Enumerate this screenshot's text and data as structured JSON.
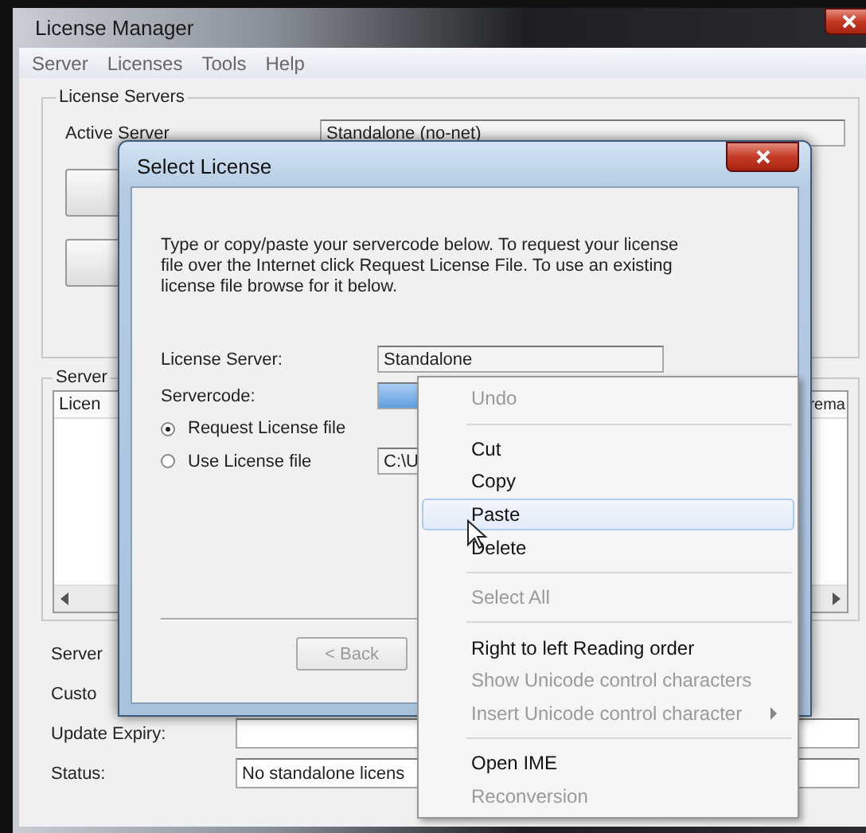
{
  "window": {
    "title": "License Manager"
  },
  "menu_bar": [
    "Server",
    "Licenses",
    "Tools",
    "Help"
  ],
  "license_servers": {
    "legend": "License Servers",
    "active_server_label": "Active Server",
    "active_server_value": "Standalone (no-net)"
  },
  "server_group": {
    "legend": "Server",
    "columns": [
      "Licen",
      "rema"
    ]
  },
  "form_rows": [
    {
      "label": "Server",
      "kind": "label"
    },
    {
      "label": "Custo",
      "kind": "label"
    },
    {
      "label": "Update Expiry:",
      "kind": "field"
    },
    {
      "label": "Status:",
      "kind": "field",
      "value": "No standalone licens"
    }
  ],
  "dialog": {
    "title": "Select License",
    "instructions": "Type or copy/paste your servercode below. To request your license file over the Internet click Request License File. To use an existing license file browse for it below.",
    "license_server_label": "License Server:",
    "license_server_value": "Standalone",
    "servercode_label": "Servercode:",
    "servercode_selected": true,
    "options": [
      {
        "label": "Request License file",
        "selected": true
      },
      {
        "label": "Use License file",
        "selected": false
      }
    ],
    "license_file_value": "C:\\U",
    "back_button": {
      "label": "< Back",
      "disabled": true
    }
  },
  "context_menu": {
    "items": [
      {
        "kind": "item",
        "label": "Undo",
        "disabled": true,
        "selected": false,
        "submenu": false
      },
      {
        "kind": "separator"
      },
      {
        "kind": "item",
        "label": "Cut",
        "disabled": false,
        "selected": false,
        "submenu": false
      },
      {
        "kind": "item",
        "label": "Copy",
        "disabled": false,
        "selected": false,
        "submenu": false
      },
      {
        "kind": "item",
        "label": "Paste",
        "disabled": false,
        "selected": true,
        "submenu": false
      },
      {
        "kind": "item",
        "label": "Delete",
        "disabled": false,
        "selected": false,
        "submenu": false
      },
      {
        "kind": "separator"
      },
      {
        "kind": "item",
        "label": "Select All",
        "disabled": true,
        "selected": false,
        "submenu": false
      },
      {
        "kind": "separator"
      },
      {
        "kind": "item",
        "label": "Right to left Reading order",
        "disabled": false,
        "selected": false,
        "submenu": false
      },
      {
        "kind": "item",
        "label": "Show Unicode control characters",
        "disabled": true,
        "selected": false,
        "submenu": false
      },
      {
        "kind": "item",
        "label": "Insert Unicode control character",
        "disabled": true,
        "selected": false,
        "submenu": true
      },
      {
        "kind": "separator"
      },
      {
        "kind": "item",
        "label": "Open IME",
        "disabled": false,
        "selected": false,
        "submenu": false
      },
      {
        "kind": "item",
        "label": "Reconversion",
        "disabled": true,
        "selected": false,
        "submenu": false
      }
    ]
  }
}
